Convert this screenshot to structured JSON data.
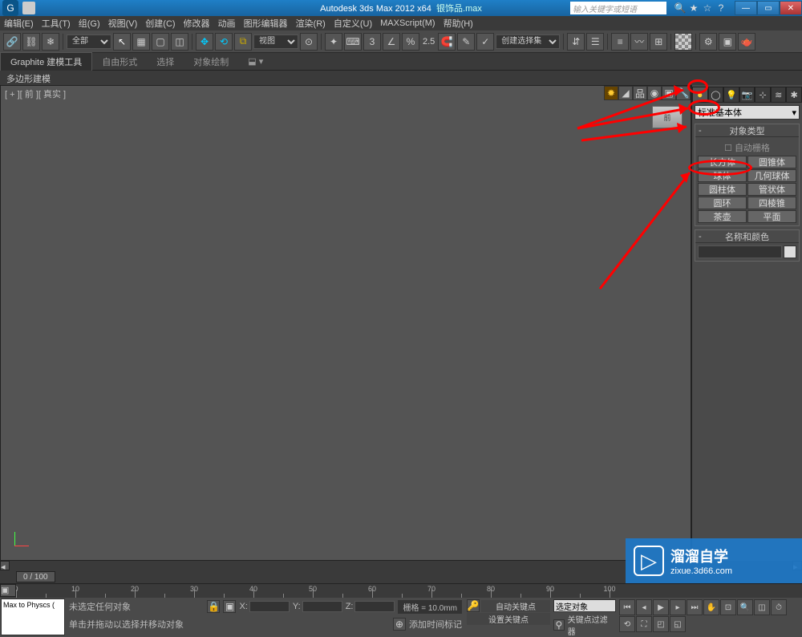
{
  "title": {
    "app": "Autodesk 3ds Max  2012 x64",
    "file": "银饰品.max"
  },
  "search_placeholder": "输入关键字或短语",
  "menu": [
    "编辑(E)",
    "工具(T)",
    "组(G)",
    "视图(V)",
    "创建(C)",
    "修改器",
    "动画",
    "图形编辑器",
    "渲染(R)",
    "自定义(U)",
    "MAXScript(M)",
    "帮助(H)"
  ],
  "toolbar": {
    "filter_dropdown": "全部",
    "view_dropdown": "视图",
    "spinner": "2.5",
    "named_set": "创建选择集"
  },
  "ribbon": {
    "tabs": [
      "Graphite 建模工具",
      "自由形式",
      "选择",
      "对象绘制"
    ],
    "sub": "多边形建模"
  },
  "viewport": {
    "label": "[ + ][ 前 ][ 真实 ]",
    "cube": "前"
  },
  "cmd_panel": {
    "dropdown": "标准基本体",
    "rollout1": "对象类型",
    "auto_grid": "自动栅格",
    "objects": [
      [
        "长方体",
        "圆锥体"
      ],
      [
        "球体",
        "几何球体"
      ],
      [
        "圆柱体",
        "管状体"
      ],
      [
        "圆环",
        "四棱锥"
      ],
      [
        "茶壶",
        "平面"
      ]
    ],
    "rollout2": "名称和颜色"
  },
  "timeline": {
    "slider": "0 / 100"
  },
  "status": {
    "script": "Max to Physcs (",
    "line1": "未选定任何对象",
    "line2": "单击并拖动以选择并移动对象",
    "add_time_tag": "添加时间标记",
    "grid": "栅格 = 10.0mm",
    "auto_key": "自动关键点",
    "set_key": "设置关键点",
    "sel_set": "选定对象",
    "key_filter": "关键点过滤器"
  },
  "watermark": {
    "big": "溜溜自学",
    "small": "zixue.3d66.com"
  }
}
